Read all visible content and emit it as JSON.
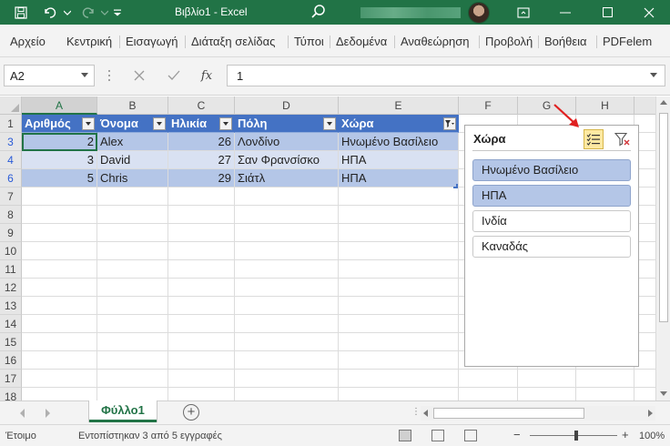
{
  "app": {
    "title": "Βιβλίο1  -  Excel",
    "accent_color": "#217346",
    "window_controls": [
      "minimize",
      "restore",
      "maximize",
      "close"
    ]
  },
  "ribbon": {
    "tabs": [
      "Αρχείο",
      "Κεντρική",
      "Εισαγωγή",
      "Διάταξη σελίδας",
      "Τύποι",
      "Δεδομένα",
      "Αναθεώρηση",
      "Προβολή",
      "Βοήθεια",
      "PDFelem"
    ]
  },
  "formula_bar": {
    "name_box": "A2",
    "fx_symbol": "fx",
    "value": "1"
  },
  "sheet": {
    "columns": [
      "A",
      "B",
      "C",
      "D",
      "E",
      "F",
      "G",
      "H"
    ],
    "visible_rows": [
      "1",
      "3",
      "4",
      "6",
      "7",
      "8",
      "9",
      "10",
      "11",
      "12",
      "13",
      "14",
      "15",
      "16",
      "17",
      "18"
    ],
    "table_headers": [
      "Αριθμός",
      "Όνομα",
      "Ηλικία",
      "Πόλη",
      "Χώρα"
    ],
    "table_rows": [
      {
        "row": "3",
        "cells": [
          "2",
          "Alex",
          "26",
          "Λονδίνο",
          "Ηνωμένο Βασίλειο"
        ]
      },
      {
        "row": "4",
        "cells": [
          "3",
          "David",
          "27",
          "Σαν Φρανσίσκο",
          "ΗΠΑ"
        ]
      },
      {
        "row": "6",
        "cells": [
          "5",
          "Chris",
          "29",
          "Σιάτλ",
          "ΗΠΑ"
        ]
      }
    ],
    "header_color": "#4472c4",
    "band_colors": [
      "#b4c6e7",
      "#d9e1f2"
    ]
  },
  "slicer": {
    "title": "Χώρα",
    "multiselect_icon": "multi-select-icon",
    "clear_icon": "clear-filter-icon",
    "items": [
      {
        "label": "Ηνωμένο Βασίλειο",
        "selected": true
      },
      {
        "label": "ΗΠΑ",
        "selected": true
      },
      {
        "label": "Ινδία",
        "selected": false
      },
      {
        "label": "Καναδάς",
        "selected": false
      }
    ],
    "selected_color": "#b4c6e7"
  },
  "sheet_tabs": {
    "active": "Φύλλο1"
  },
  "status_bar": {
    "mode": "Έτοιμο",
    "filter_info": "Εντοπίστηκαν 3 από 5 εγγραφές",
    "zoom": "100%",
    "zoom_minus": "−",
    "zoom_plus": "+"
  }
}
